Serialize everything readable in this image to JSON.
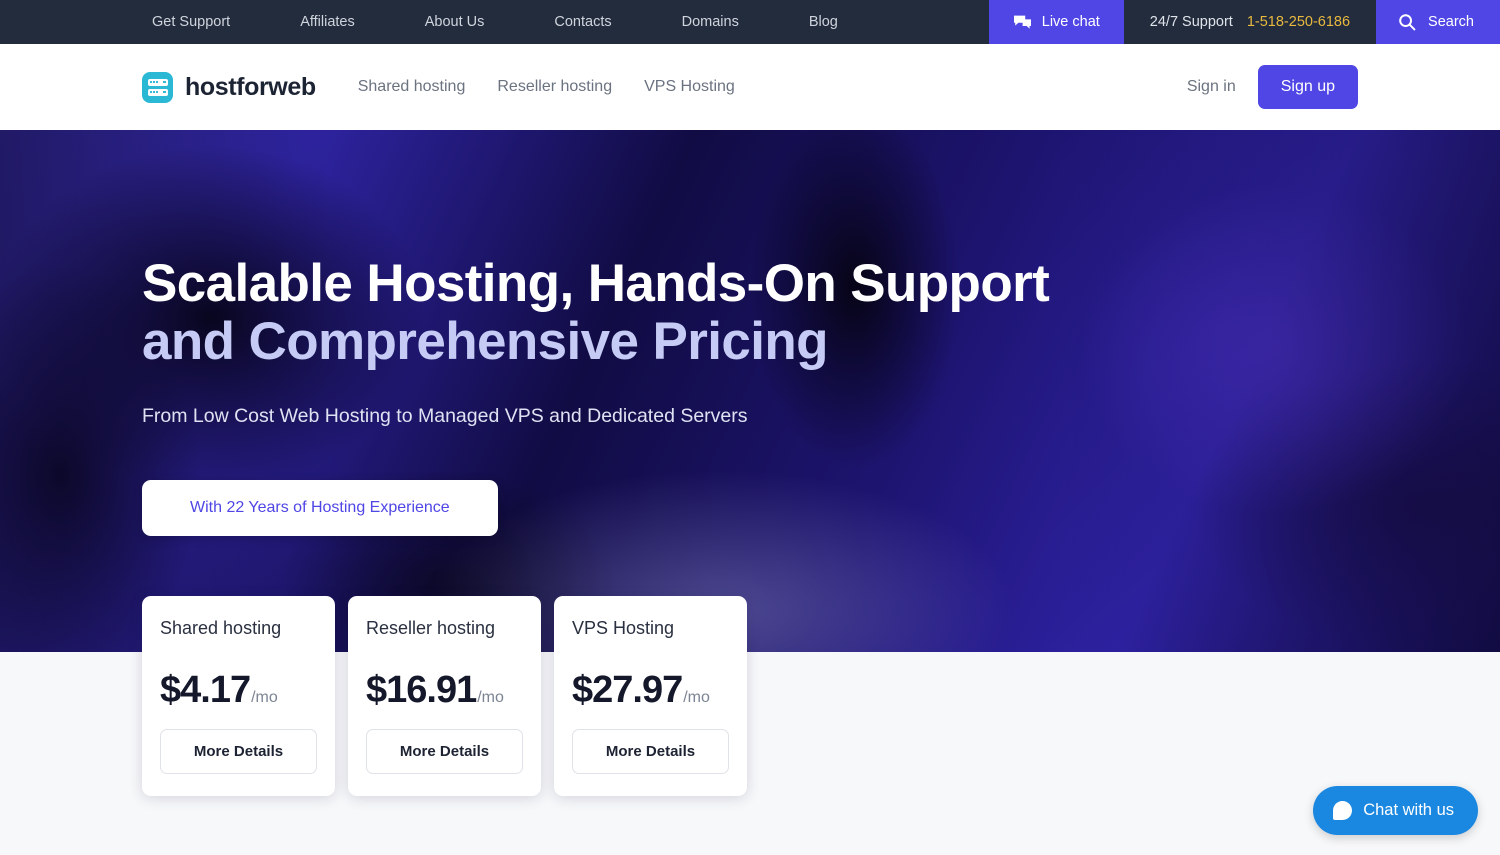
{
  "topbar": {
    "links": [
      {
        "label": "Get Support"
      },
      {
        "label": "Affiliates"
      },
      {
        "label": "About Us"
      },
      {
        "label": "Contacts"
      },
      {
        "label": "Domains"
      },
      {
        "label": "Blog"
      }
    ],
    "live_chat_label": "Live chat",
    "live_chat_icon": "chat-bubbles-icon",
    "support_label": "24/7 Support",
    "support_phone": "1-518-250-6186",
    "search_label": "Search",
    "search_icon": "search-icon",
    "bg_color": "#232c3d",
    "accent_color": "#4f46e5",
    "phone_color": "#e8b93e"
  },
  "header": {
    "brand_name": "hostforweb",
    "brand_icon": "server-rack-icon",
    "brand_icon_color": "#2bb8d4",
    "nav": [
      {
        "label": "Shared hosting"
      },
      {
        "label": "Reseller hosting"
      },
      {
        "label": "VPS Hosting"
      }
    ],
    "sign_in_label": "Sign in",
    "sign_up_label": "Sign up",
    "sign_up_color": "#4f46e5"
  },
  "hero": {
    "title_line1": "Scalable Hosting, Hands-On Support",
    "title_line2": "and Comprehensive Pricing",
    "subtitle": "From Low Cost Web Hosting to Managed VPS and Dedicated Servers",
    "badge_label": "With 22 Years of Hosting Experience",
    "title_color": "#ffffff",
    "title_line2_color": "#c5cbf4",
    "badge_text_color": "#4f46e5"
  },
  "pricing": {
    "cards": [
      {
        "title": "Shared hosting",
        "price": "$4.17",
        "period": "/mo",
        "cta": "More Details"
      },
      {
        "title": "Reseller hosting",
        "price": "$16.91",
        "period": "/mo",
        "cta": "More Details"
      },
      {
        "title": "VPS Hosting",
        "price": "$27.97",
        "period": "/mo",
        "cta": "More Details"
      }
    ]
  },
  "chat_widget": {
    "label": "Chat with us",
    "icon": "chat-bubble-icon",
    "color": "#1a87e0"
  }
}
